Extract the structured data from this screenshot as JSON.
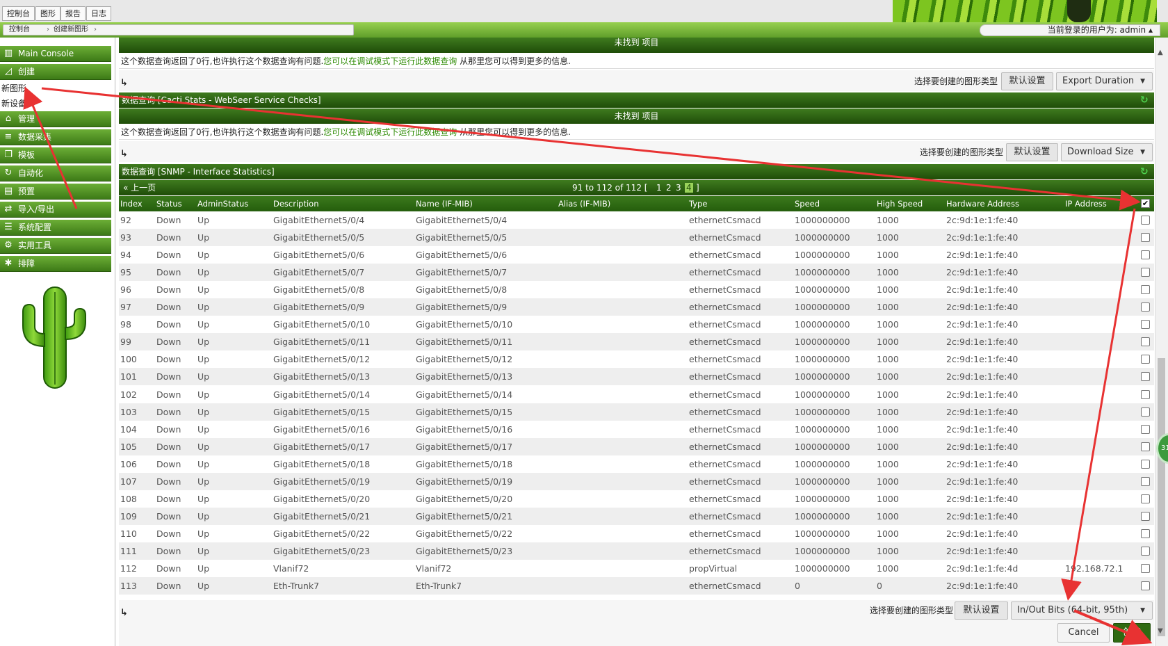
{
  "tabs": [
    "控制台",
    "图形",
    "报告",
    "日志"
  ],
  "breadcrumb": [
    "控制台",
    "创建新图形"
  ],
  "user_text": "当前登录的用户为: admin ▴",
  "sidebar": {
    "items": [
      {
        "label": "Main Console",
        "icon": "map-icon"
      },
      {
        "label": "创建",
        "icon": "chart-area-icon"
      },
      {
        "label": "管理",
        "icon": "home-icon"
      },
      {
        "label": "数据采集",
        "icon": "database-icon"
      },
      {
        "label": "模板",
        "icon": "copy-icon"
      },
      {
        "label": "自动化",
        "icon": "refresh-icon"
      },
      {
        "label": "预置",
        "icon": "box-icon"
      },
      {
        "label": "导入/导出",
        "icon": "exchange-icon"
      },
      {
        "label": "系统配置",
        "icon": "sliders-icon"
      },
      {
        "label": "实用工具",
        "icon": "gears-icon"
      },
      {
        "label": "排障",
        "icon": "bug-icon"
      }
    ],
    "subitems": [
      "新图形",
      "新设备"
    ]
  },
  "section_top": {
    "notfound": "未找到 项目",
    "msg_prefix": "这个数据查询返回了0行,也许执行这个数据查询有问题.",
    "msg_link": "您可以在调试模式下运行此数据查询",
    "msg_suffix": " 从那里您可以得到更多的信息.",
    "graph_type_label": "选择要创建的图形类型",
    "default_btn": "默认设置",
    "select_value": "Export Duration"
  },
  "section_webseer": {
    "title": "数据查询 [Cacti Stats - WebSeer Service Checks]",
    "notfound": "未找到 项目",
    "msg_prefix": "这个数据查询返回了0行,也许执行这个数据查询有问题.",
    "msg_link": "您可以在调试模式下运行此数据查询",
    "msg_suffix": " 从那里您可以得到更多的信息.",
    "graph_type_label": "选择要创建的图形类型",
    "default_btn": "默认设置",
    "select_value": "Download Size"
  },
  "section_snmp": {
    "title": "数据查询 [SNMP - Interface Statistics]",
    "prev_label": "上一页",
    "pager_text": "91 to 112 of 112 [",
    "pages": [
      "1",
      "2",
      "3",
      "4"
    ],
    "pager_close": "]",
    "columns": [
      "Index",
      "Status",
      "AdminStatus",
      "Description",
      "Name (IF-MIB)",
      "Alias (IF-MIB)",
      "Type",
      "Speed",
      "High Speed",
      "Hardware Address",
      "IP Address"
    ],
    "header_check": "✔",
    "rows": [
      [
        "92",
        "Down",
        "Up",
        "GigabitEthernet5/0/4",
        "GigabitEthernet5/0/4",
        "",
        "ethernetCsmacd",
        "1000000000",
        "1000",
        "2c:9d:1e:1:fe:40",
        ""
      ],
      [
        "93",
        "Down",
        "Up",
        "GigabitEthernet5/0/5",
        "GigabitEthernet5/0/5",
        "",
        "ethernetCsmacd",
        "1000000000",
        "1000",
        "2c:9d:1e:1:fe:40",
        ""
      ],
      [
        "94",
        "Down",
        "Up",
        "GigabitEthernet5/0/6",
        "GigabitEthernet5/0/6",
        "",
        "ethernetCsmacd",
        "1000000000",
        "1000",
        "2c:9d:1e:1:fe:40",
        ""
      ],
      [
        "95",
        "Down",
        "Up",
        "GigabitEthernet5/0/7",
        "GigabitEthernet5/0/7",
        "",
        "ethernetCsmacd",
        "1000000000",
        "1000",
        "2c:9d:1e:1:fe:40",
        ""
      ],
      [
        "96",
        "Down",
        "Up",
        "GigabitEthernet5/0/8",
        "GigabitEthernet5/0/8",
        "",
        "ethernetCsmacd",
        "1000000000",
        "1000",
        "2c:9d:1e:1:fe:40",
        ""
      ],
      [
        "97",
        "Down",
        "Up",
        "GigabitEthernet5/0/9",
        "GigabitEthernet5/0/9",
        "",
        "ethernetCsmacd",
        "1000000000",
        "1000",
        "2c:9d:1e:1:fe:40",
        ""
      ],
      [
        "98",
        "Down",
        "Up",
        "GigabitEthernet5/0/10",
        "GigabitEthernet5/0/10",
        "",
        "ethernetCsmacd",
        "1000000000",
        "1000",
        "2c:9d:1e:1:fe:40",
        ""
      ],
      [
        "99",
        "Down",
        "Up",
        "GigabitEthernet5/0/11",
        "GigabitEthernet5/0/11",
        "",
        "ethernetCsmacd",
        "1000000000",
        "1000",
        "2c:9d:1e:1:fe:40",
        ""
      ],
      [
        "100",
        "Down",
        "Up",
        "GigabitEthernet5/0/12",
        "GigabitEthernet5/0/12",
        "",
        "ethernetCsmacd",
        "1000000000",
        "1000",
        "2c:9d:1e:1:fe:40",
        ""
      ],
      [
        "101",
        "Down",
        "Up",
        "GigabitEthernet5/0/13",
        "GigabitEthernet5/0/13",
        "",
        "ethernetCsmacd",
        "1000000000",
        "1000",
        "2c:9d:1e:1:fe:40",
        ""
      ],
      [
        "102",
        "Down",
        "Up",
        "GigabitEthernet5/0/14",
        "GigabitEthernet5/0/14",
        "",
        "ethernetCsmacd",
        "1000000000",
        "1000",
        "2c:9d:1e:1:fe:40",
        ""
      ],
      [
        "103",
        "Down",
        "Up",
        "GigabitEthernet5/0/15",
        "GigabitEthernet5/0/15",
        "",
        "ethernetCsmacd",
        "1000000000",
        "1000",
        "2c:9d:1e:1:fe:40",
        ""
      ],
      [
        "104",
        "Down",
        "Up",
        "GigabitEthernet5/0/16",
        "GigabitEthernet5/0/16",
        "",
        "ethernetCsmacd",
        "1000000000",
        "1000",
        "2c:9d:1e:1:fe:40",
        ""
      ],
      [
        "105",
        "Down",
        "Up",
        "GigabitEthernet5/0/17",
        "GigabitEthernet5/0/17",
        "",
        "ethernetCsmacd",
        "1000000000",
        "1000",
        "2c:9d:1e:1:fe:40",
        ""
      ],
      [
        "106",
        "Down",
        "Up",
        "GigabitEthernet5/0/18",
        "GigabitEthernet5/0/18",
        "",
        "ethernetCsmacd",
        "1000000000",
        "1000",
        "2c:9d:1e:1:fe:40",
        ""
      ],
      [
        "107",
        "Down",
        "Up",
        "GigabitEthernet5/0/19",
        "GigabitEthernet5/0/19",
        "",
        "ethernetCsmacd",
        "1000000000",
        "1000",
        "2c:9d:1e:1:fe:40",
        ""
      ],
      [
        "108",
        "Down",
        "Up",
        "GigabitEthernet5/0/20",
        "GigabitEthernet5/0/20",
        "",
        "ethernetCsmacd",
        "1000000000",
        "1000",
        "2c:9d:1e:1:fe:40",
        ""
      ],
      [
        "109",
        "Down",
        "Up",
        "GigabitEthernet5/0/21",
        "GigabitEthernet5/0/21",
        "",
        "ethernetCsmacd",
        "1000000000",
        "1000",
        "2c:9d:1e:1:fe:40",
        ""
      ],
      [
        "110",
        "Down",
        "Up",
        "GigabitEthernet5/0/22",
        "GigabitEthernet5/0/22",
        "",
        "ethernetCsmacd",
        "1000000000",
        "1000",
        "2c:9d:1e:1:fe:40",
        ""
      ],
      [
        "111",
        "Down",
        "Up",
        "GigabitEthernet5/0/23",
        "GigabitEthernet5/0/23",
        "",
        "ethernetCsmacd",
        "1000000000",
        "1000",
        "2c:9d:1e:1:fe:40",
        ""
      ],
      [
        "112",
        "Down",
        "Up",
        "Vlanif72",
        "Vlanif72",
        "",
        "propVirtual",
        "1000000000",
        "1000",
        "2c:9d:1e:1:fe:4d",
        "192.168.72.1"
      ],
      [
        "113",
        "Down",
        "Up",
        "Eth-Trunk7",
        "Eth-Trunk7",
        "",
        "ethernetCsmacd",
        "0",
        "0",
        "2c:9d:1e:1:fe:40",
        ""
      ]
    ],
    "graph_type_label": "选择要创建的图形类型",
    "default_btn": "默认设置",
    "select_value": "In/Out Bits (64-bit, 95th)"
  },
  "footer": {
    "cancel": "Cancel",
    "create": "创建"
  },
  "badge_text": "31",
  "colors": {
    "nav_green": "#4a8a22",
    "header_green": "#2f6a12",
    "link_green": "#2b8a00",
    "annotation_red": "#e83232"
  }
}
